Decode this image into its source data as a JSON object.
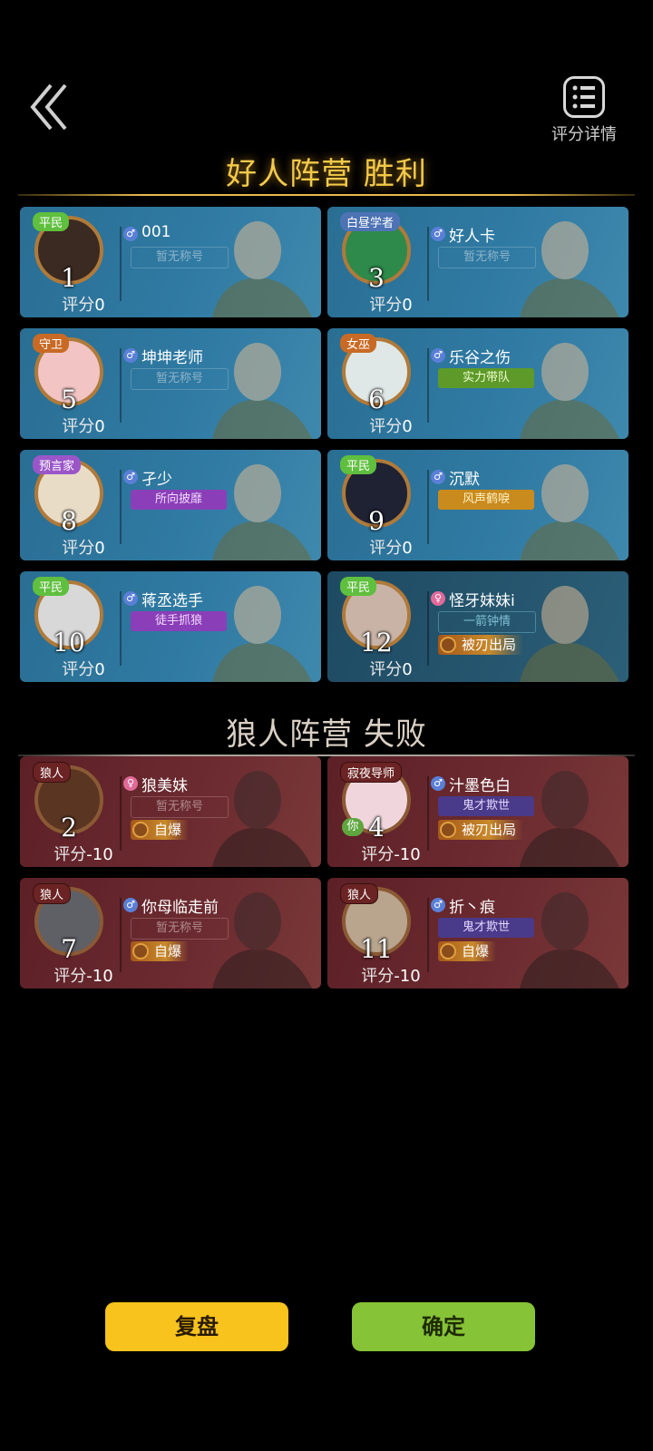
{
  "header": {
    "detail_label": "评分详情"
  },
  "good_title": "好人阵营  胜利",
  "wolf_title": "狼人阵营  失败",
  "score_label": "评分",
  "good_players": [
    {
      "seat": "1",
      "role": "平民",
      "role_color": "green",
      "gender": "m",
      "name": "001",
      "title": "暂无称号",
      "title_style": "none",
      "score": "0",
      "avatar_color": "#3b2a22",
      "dim": false
    },
    {
      "seat": "3",
      "role": "白昼学者",
      "role_color": "blue",
      "gender": "m",
      "name": "好人卡",
      "title": "暂无称号",
      "title_style": "none",
      "score": "0",
      "avatar_color": "#2d8a4a",
      "dim": false
    },
    {
      "seat": "5",
      "role": "守卫",
      "role_color": "orange",
      "gender": "m",
      "name": "坤坤老师",
      "title": "暂无称号",
      "title_style": "none",
      "score": "0",
      "avatar_color": "#f2c4c4",
      "dim": false
    },
    {
      "seat": "6",
      "role": "女巫",
      "role_color": "orange",
      "gender": "m",
      "name": "乐谷之伤",
      "title": "实力带队",
      "title_style": "green",
      "score": "0",
      "avatar_color": "#dfe8e6",
      "dim": false
    },
    {
      "seat": "8",
      "role": "预言家",
      "role_color": "purple",
      "gender": "m",
      "name": "孑少",
      "title": "所向披靡",
      "title_style": "purple",
      "score": "0",
      "avatar_color": "#e9dcc7",
      "dim": false
    },
    {
      "seat": "9",
      "role": "平民",
      "role_color": "green",
      "gender": "m",
      "name": "沉默",
      "title": "风声鹤唳",
      "title_style": "gold",
      "score": "0",
      "avatar_color": "#1f2233",
      "dim": false
    },
    {
      "seat": "10",
      "role": "平民",
      "role_color": "green",
      "gender": "m",
      "name": "蒋丞选手",
      "title": "徒手抓狼",
      "title_style": "purple",
      "score": "0",
      "avatar_color": "#d8d8d8",
      "dim": false
    },
    {
      "seat": "12",
      "role": "平民",
      "role_color": "green",
      "gender": "f",
      "name": "怪牙妹妹i",
      "title": "一箭钟情",
      "title_style": "teal",
      "score": "0",
      "avatar_color": "#c9b3a6",
      "dim": true,
      "badge": "被刃出局"
    }
  ],
  "wolf_players": [
    {
      "seat": "2",
      "role": "狼人",
      "gender": "f",
      "name": "狼美妹",
      "title": "暂无称号",
      "title_style": "none",
      "score": "-10",
      "avatar_color": "#5a3522",
      "badge": "自爆",
      "you": false
    },
    {
      "seat": "4",
      "role": "寂夜导师",
      "gender": "m",
      "name": "汁墨色白",
      "title": "鬼才欺世",
      "title_style": "violet",
      "score": "-10",
      "avatar_color": "#f0d6dc",
      "badge": "被刃出局",
      "you": true
    },
    {
      "seat": "7",
      "role": "狼人",
      "gender": "m",
      "name": "你母临走前",
      "title": "暂无称号",
      "title_style": "none",
      "score": "-10",
      "avatar_color": "#5f5f66",
      "badge": "自爆",
      "you": false
    },
    {
      "seat": "11",
      "role": "狼人",
      "gender": "m",
      "name": "折丶痕",
      "title": "鬼才欺世",
      "title_style": "violet",
      "score": "-10",
      "avatar_color": "#b9a58e",
      "badge": "自爆",
      "you": false
    }
  ],
  "you_label": "你",
  "buttons": {
    "replay": "复盘",
    "confirm": "确定"
  }
}
